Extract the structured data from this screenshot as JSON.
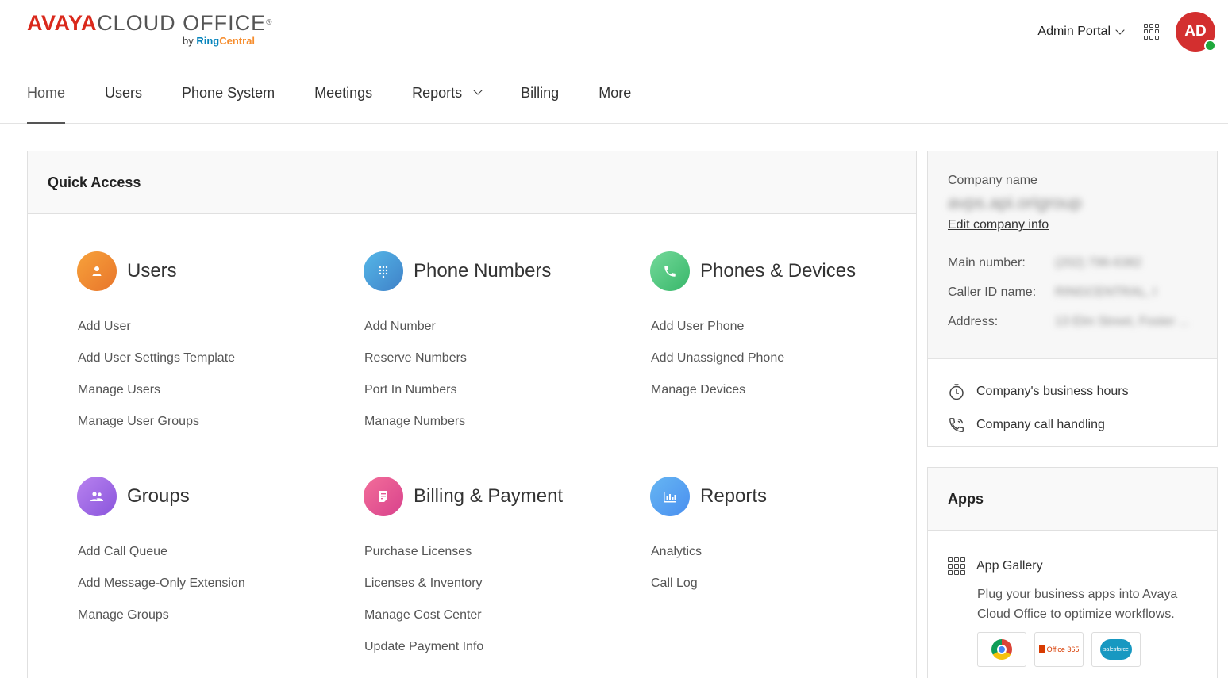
{
  "header": {
    "logo": {
      "brand": "AVAYA",
      "product": "CLOUD OFFICE",
      "reg": "®",
      "sub_by": "by",
      "sub_ring": "Ring",
      "sub_central": "Central"
    },
    "admin_portal_label": "Admin Portal",
    "avatar_initials": "AD",
    "presence_color": "#1fa83c"
  },
  "nav": {
    "items": [
      {
        "label": "Home",
        "active": true
      },
      {
        "label": "Users"
      },
      {
        "label": "Phone System"
      },
      {
        "label": "Meetings"
      },
      {
        "label": "Reports",
        "has_dropdown": true
      },
      {
        "label": "Billing"
      },
      {
        "label": "More"
      }
    ]
  },
  "quick_access": {
    "title": "Quick Access",
    "sections": [
      {
        "title": "Users",
        "icon": "user-icon",
        "color": "#f08a30",
        "links": [
          "Add User",
          "Add User Settings Template",
          "Manage Users",
          "Manage User Groups"
        ]
      },
      {
        "title": "Phone Numbers",
        "icon": "dialpad-icon",
        "color": "#4a9bd8",
        "links": [
          "Add Number",
          "Reserve Numbers",
          "Port In Numbers",
          "Manage Numbers"
        ]
      },
      {
        "title": "Phones & Devices",
        "icon": "phone-icon",
        "color": "#4cc47e",
        "links": [
          "Add User Phone",
          "Add Unassigned Phone",
          "Manage Devices"
        ]
      },
      {
        "title": "Groups",
        "icon": "group-icon",
        "color": "#a06ce6",
        "links": [
          "Add Call Queue",
          "Add Message-Only Extension",
          "Manage Groups"
        ]
      },
      {
        "title": "Billing & Payment",
        "icon": "invoice-icon",
        "color": "#e55893",
        "links": [
          "Purchase Licenses",
          "Licenses & Inventory",
          "Manage Cost Center",
          "Update Payment Info"
        ]
      },
      {
        "title": "Reports",
        "icon": "bar-chart-icon",
        "color": "#57a2f1",
        "links": [
          "Analytics",
          "Call Log"
        ]
      }
    ]
  },
  "company": {
    "name_label": "Company name",
    "name_value": "avps.api.origroup",
    "edit_link": "Edit company info",
    "rows": [
      {
        "key": "Main number:",
        "value": "(202) 796-6382"
      },
      {
        "key": "Caller ID name:",
        "value": "RINGCENTRAL, I"
      },
      {
        "key": "Address:",
        "value": "13 Elm Street, Foster ..."
      }
    ],
    "links": [
      {
        "label": "Company's business hours",
        "icon": "stopwatch-icon"
      },
      {
        "label": "Company call handling",
        "icon": "phone-outline-icon"
      }
    ]
  },
  "apps": {
    "title": "Apps",
    "gallery_label": "App Gallery",
    "gallery_desc": "Plug your business apps into Avaya Cloud Office to optimize workflows.",
    "tiles": [
      {
        "name": "chrome",
        "icon": "chrome-icon"
      },
      {
        "name": "office365",
        "label": "Office 365",
        "icon": "office365-icon"
      },
      {
        "name": "salesforce",
        "label": "salesforce",
        "icon": "salesforce-icon"
      }
    ]
  }
}
